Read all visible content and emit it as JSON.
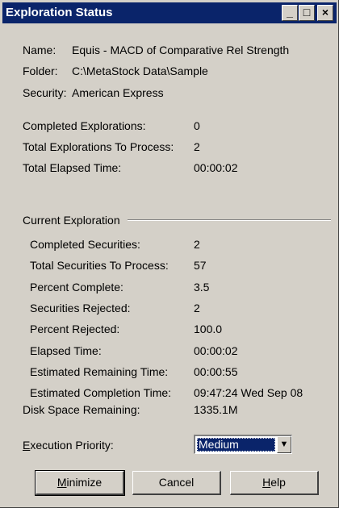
{
  "window": {
    "title": "Exploration Status",
    "minimize_glyph": "_",
    "maximize_glyph": "□",
    "close_glyph": "×"
  },
  "info": {
    "name_label": "Name:",
    "name_value": "Equis - MACD of Comparative Rel Strength",
    "folder_label": "Folder:",
    "folder_value": "C:\\MetaStock Data\\Sample",
    "security_label": "Security:",
    "security_value": "American Express"
  },
  "totals": {
    "completed_label": "Completed Explorations:",
    "completed_value": "0",
    "to_process_label": "Total Explorations To Process:",
    "to_process_value": "2",
    "elapsed_label": "Total Elapsed Time:",
    "elapsed_value": "00:00:02"
  },
  "current": {
    "section_label": "Current Exploration",
    "rows": [
      {
        "label": "Completed Securities:",
        "value": "2"
      },
      {
        "label": "Total Securities To Process:",
        "value": "57"
      },
      {
        "label": "Percent Complete:",
        "value": "3.5"
      },
      {
        "label": "Securities Rejected:",
        "value": "2"
      },
      {
        "label": "Percent Rejected:",
        "value": "100.0"
      },
      {
        "label": "Elapsed Time:",
        "value": "00:00:02"
      },
      {
        "label": "Estimated Remaining Time:",
        "value": "00:00:55"
      },
      {
        "label": "Estimated Completion Time:",
        "value": "09:47:24 Wed Sep 08"
      }
    ]
  },
  "disk": {
    "label": "Disk Space Remaining:",
    "value": "1335.1M"
  },
  "priority": {
    "label_prefix": "E",
    "label_rest": "xecution Priority:",
    "selected": "Medium",
    "arrow_glyph": "▼"
  },
  "buttons": {
    "minimize_u": "M",
    "minimize_rest": "inimize",
    "cancel": "Cancel",
    "help_u": "H",
    "help_rest": "elp"
  },
  "colors": {
    "face": "#d4d0c8",
    "titlebar": "#0a246a",
    "highlight": "#0a246a"
  }
}
